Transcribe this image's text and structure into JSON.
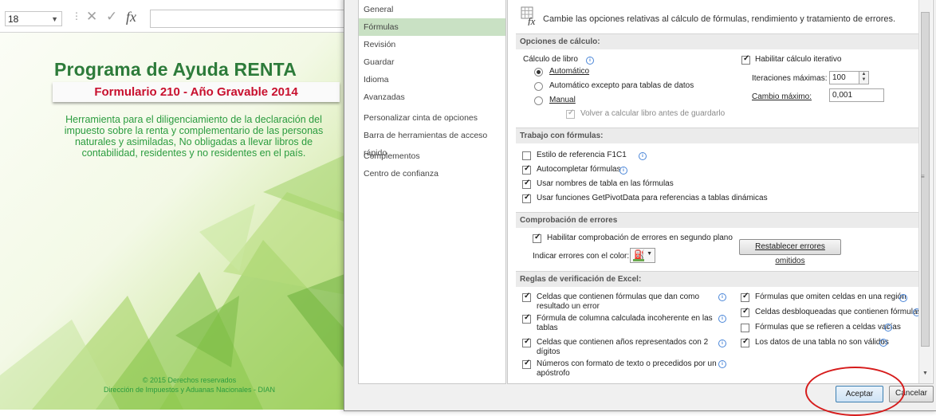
{
  "excel": {
    "name_box": "18",
    "fx": "fx",
    "title": "Programa de Ayuda RENTA",
    "subtitle": "Formulario 210 - Año Gravable 2014",
    "description": "Herramienta para el diligenciamiento de la declaración del impuesto sobre la renta y complementario de las personas naturales y asimiladas, No obligadas a llevar libros de contabilidad, residentes y no residentes en el país.",
    "copyright": "© 2015 Derechos reservados",
    "institution": "Dirección de Impuestos y Aduanas Nacionales - DIAN"
  },
  "nav": {
    "items": [
      "General",
      "Fórmulas",
      "Revisión",
      "Guardar",
      "Idioma",
      "Avanzadas",
      "Personalizar cinta de opciones",
      "Barra de herramientas de acceso rápido",
      "Complementos",
      "Centro de confianza"
    ],
    "selected": "Fórmulas"
  },
  "header_text": "Cambie las opciones relativas al cálculo de fórmulas, rendimiento y tratamiento de errores.",
  "calc": {
    "section": "Opciones de cálculo:",
    "workbook_label": "Cálculo de libro",
    "auto": "Automático",
    "auto_except": "Automático excepto para tablas de datos",
    "manual": "Manual",
    "recalc_before_save": "Volver a calcular libro antes de guardarlo",
    "iterative": "Habilitar cálculo iterativo",
    "max_iter_label": "Iteraciones máximas:",
    "max_iter_value": "100",
    "max_change_label": "Cambio máximo:",
    "max_change_value": "0,001"
  },
  "formulas": {
    "section": "Trabajo con fórmulas:",
    "r1c1": "Estilo de referencia F1C1",
    "autocomplete": "Autocompletar fórmulas",
    "table_names": "Usar nombres de tabla en las fórmulas",
    "getpivot": "Usar funciones GetPivotData para referencias a tablas dinámicas"
  },
  "errors": {
    "section": "Comprobación de errores",
    "enable": "Habilitar comprobación de errores en segundo plano",
    "color_label": "Indicar errores con el color:",
    "reset_button": "Restablecer errores omitidos"
  },
  "rules": {
    "section": "Reglas de verificación de Excel:",
    "left": [
      {
        "line1": "Celdas que contienen fórmulas que dan como",
        "line2": "resultado un error",
        "checked": true
      },
      {
        "line1": "Fórmula de columna calculada incoherente en las",
        "line2": "tablas",
        "checked": true
      },
      {
        "line1": "Celdas que contienen años representados con 2",
        "line2": "dígitos",
        "checked": true
      },
      {
        "line1": "Números con formato de texto o precedidos por un",
        "line2": "apóstrofo",
        "checked": true
      }
    ],
    "right": [
      {
        "label": "Fórmulas que omiten celdas en una región",
        "checked": true
      },
      {
        "label": "Celdas desbloqueadas que contienen fórmulas",
        "checked": true
      },
      {
        "label": "Fórmulas que se refieren a celdas vacías",
        "checked": false
      },
      {
        "label": "Los datos de una tabla no son válidos",
        "checked": true
      }
    ]
  },
  "buttons": {
    "ok": "Aceptar",
    "cancel": "Cancelar"
  },
  "colors": {
    "nav_selected": "#c9e1c4",
    "title_green": "#2d7b3a",
    "subtitle_red": "#c8102e",
    "annotation_red": "#d61c1c"
  }
}
